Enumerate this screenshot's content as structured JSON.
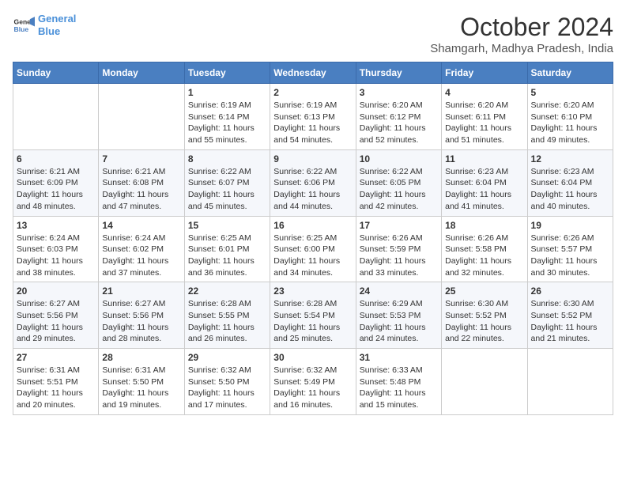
{
  "header": {
    "logo_line1": "General",
    "logo_line2": "Blue",
    "title": "October 2024",
    "subtitle": "Shamgarh, Madhya Pradesh, India"
  },
  "days_of_week": [
    "Sunday",
    "Monday",
    "Tuesday",
    "Wednesday",
    "Thursday",
    "Friday",
    "Saturday"
  ],
  "weeks": [
    [
      {
        "day": "",
        "lines": []
      },
      {
        "day": "",
        "lines": []
      },
      {
        "day": "1",
        "lines": [
          "Sunrise: 6:19 AM",
          "Sunset: 6:14 PM",
          "Daylight: 11 hours",
          "and 55 minutes."
        ]
      },
      {
        "day": "2",
        "lines": [
          "Sunrise: 6:19 AM",
          "Sunset: 6:13 PM",
          "Daylight: 11 hours",
          "and 54 minutes."
        ]
      },
      {
        "day": "3",
        "lines": [
          "Sunrise: 6:20 AM",
          "Sunset: 6:12 PM",
          "Daylight: 11 hours",
          "and 52 minutes."
        ]
      },
      {
        "day": "4",
        "lines": [
          "Sunrise: 6:20 AM",
          "Sunset: 6:11 PM",
          "Daylight: 11 hours",
          "and 51 minutes."
        ]
      },
      {
        "day": "5",
        "lines": [
          "Sunrise: 6:20 AM",
          "Sunset: 6:10 PM",
          "Daylight: 11 hours",
          "and 49 minutes."
        ]
      }
    ],
    [
      {
        "day": "6",
        "lines": [
          "Sunrise: 6:21 AM",
          "Sunset: 6:09 PM",
          "Daylight: 11 hours",
          "and 48 minutes."
        ]
      },
      {
        "day": "7",
        "lines": [
          "Sunrise: 6:21 AM",
          "Sunset: 6:08 PM",
          "Daylight: 11 hours",
          "and 47 minutes."
        ]
      },
      {
        "day": "8",
        "lines": [
          "Sunrise: 6:22 AM",
          "Sunset: 6:07 PM",
          "Daylight: 11 hours",
          "and 45 minutes."
        ]
      },
      {
        "day": "9",
        "lines": [
          "Sunrise: 6:22 AM",
          "Sunset: 6:06 PM",
          "Daylight: 11 hours",
          "and 44 minutes."
        ]
      },
      {
        "day": "10",
        "lines": [
          "Sunrise: 6:22 AM",
          "Sunset: 6:05 PM",
          "Daylight: 11 hours",
          "and 42 minutes."
        ]
      },
      {
        "day": "11",
        "lines": [
          "Sunrise: 6:23 AM",
          "Sunset: 6:04 PM",
          "Daylight: 11 hours",
          "and 41 minutes."
        ]
      },
      {
        "day": "12",
        "lines": [
          "Sunrise: 6:23 AM",
          "Sunset: 6:04 PM",
          "Daylight: 11 hours",
          "and 40 minutes."
        ]
      }
    ],
    [
      {
        "day": "13",
        "lines": [
          "Sunrise: 6:24 AM",
          "Sunset: 6:03 PM",
          "Daylight: 11 hours",
          "and 38 minutes."
        ]
      },
      {
        "day": "14",
        "lines": [
          "Sunrise: 6:24 AM",
          "Sunset: 6:02 PM",
          "Daylight: 11 hours",
          "and 37 minutes."
        ]
      },
      {
        "day": "15",
        "lines": [
          "Sunrise: 6:25 AM",
          "Sunset: 6:01 PM",
          "Daylight: 11 hours",
          "and 36 minutes."
        ]
      },
      {
        "day": "16",
        "lines": [
          "Sunrise: 6:25 AM",
          "Sunset: 6:00 PM",
          "Daylight: 11 hours",
          "and 34 minutes."
        ]
      },
      {
        "day": "17",
        "lines": [
          "Sunrise: 6:26 AM",
          "Sunset: 5:59 PM",
          "Daylight: 11 hours",
          "and 33 minutes."
        ]
      },
      {
        "day": "18",
        "lines": [
          "Sunrise: 6:26 AM",
          "Sunset: 5:58 PM",
          "Daylight: 11 hours",
          "and 32 minutes."
        ]
      },
      {
        "day": "19",
        "lines": [
          "Sunrise: 6:26 AM",
          "Sunset: 5:57 PM",
          "Daylight: 11 hours",
          "and 30 minutes."
        ]
      }
    ],
    [
      {
        "day": "20",
        "lines": [
          "Sunrise: 6:27 AM",
          "Sunset: 5:56 PM",
          "Daylight: 11 hours",
          "and 29 minutes."
        ]
      },
      {
        "day": "21",
        "lines": [
          "Sunrise: 6:27 AM",
          "Sunset: 5:56 PM",
          "Daylight: 11 hours",
          "and 28 minutes."
        ]
      },
      {
        "day": "22",
        "lines": [
          "Sunrise: 6:28 AM",
          "Sunset: 5:55 PM",
          "Daylight: 11 hours",
          "and 26 minutes."
        ]
      },
      {
        "day": "23",
        "lines": [
          "Sunrise: 6:28 AM",
          "Sunset: 5:54 PM",
          "Daylight: 11 hours",
          "and 25 minutes."
        ]
      },
      {
        "day": "24",
        "lines": [
          "Sunrise: 6:29 AM",
          "Sunset: 5:53 PM",
          "Daylight: 11 hours",
          "and 24 minutes."
        ]
      },
      {
        "day": "25",
        "lines": [
          "Sunrise: 6:30 AM",
          "Sunset: 5:52 PM",
          "Daylight: 11 hours",
          "and 22 minutes."
        ]
      },
      {
        "day": "26",
        "lines": [
          "Sunrise: 6:30 AM",
          "Sunset: 5:52 PM",
          "Daylight: 11 hours",
          "and 21 minutes."
        ]
      }
    ],
    [
      {
        "day": "27",
        "lines": [
          "Sunrise: 6:31 AM",
          "Sunset: 5:51 PM",
          "Daylight: 11 hours",
          "and 20 minutes."
        ]
      },
      {
        "day": "28",
        "lines": [
          "Sunrise: 6:31 AM",
          "Sunset: 5:50 PM",
          "Daylight: 11 hours",
          "and 19 minutes."
        ]
      },
      {
        "day": "29",
        "lines": [
          "Sunrise: 6:32 AM",
          "Sunset: 5:50 PM",
          "Daylight: 11 hours",
          "and 17 minutes."
        ]
      },
      {
        "day": "30",
        "lines": [
          "Sunrise: 6:32 AM",
          "Sunset: 5:49 PM",
          "Daylight: 11 hours",
          "and 16 minutes."
        ]
      },
      {
        "day": "31",
        "lines": [
          "Sunrise: 6:33 AM",
          "Sunset: 5:48 PM",
          "Daylight: 11 hours",
          "and 15 minutes."
        ]
      },
      {
        "day": "",
        "lines": []
      },
      {
        "day": "",
        "lines": []
      }
    ]
  ]
}
